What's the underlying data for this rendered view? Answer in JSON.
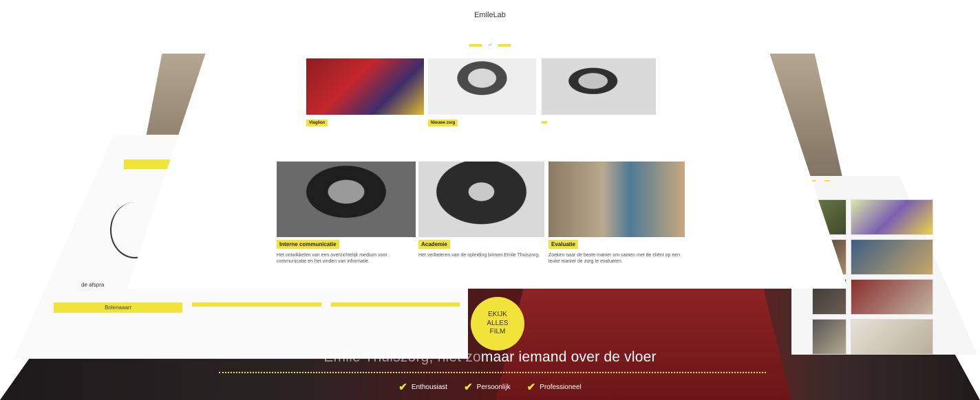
{
  "colors": {
    "accent": "#f2e33a",
    "hero_dark": "#1c1a1b",
    "hero_red": "#7b1d1d"
  },
  "front": {
    "title": "EmileLab",
    "subtitle": "",
    "intro": "",
    "buttons": [
      "",
      ""
    ],
    "separator": "of",
    "cards": [
      {
        "label": "Vlaglion",
        "text": ""
      },
      {
        "label": "Nieuwe zorg",
        "text": ""
      },
      {
        "label": "",
        "text": ""
      },
      {
        "label": "Interne communicatie",
        "text": "Het ontwikkelen van een overzichtelijk medium voor communicatie en het vinden van informatie."
      },
      {
        "label": "Academie",
        "text": "Het verbeteren van de opleiding binnen Emile Thuiszorg."
      },
      {
        "label": "Evaluatie",
        "text": "Zoeken naar de beste manier om samen met de cliënt op een leuke manier de zorg te evalueren."
      }
    ]
  },
  "left_panel": {
    "link_text": "de afspra",
    "columns": [
      {
        "head": "Bolenaaarr",
        "lines": [
          "",
          ""
        ]
      },
      {
        "head": "",
        "lines": [
          ""
        ]
      },
      {
        "head": "",
        "lines": [
          ""
        ]
      }
    ]
  },
  "right_panel": {
    "tabs": [
      "",
      ""
    ],
    "thumb_count": 8
  },
  "hero": {
    "tagline_dim": "Emile Thuiszorg, niet zo",
    "tagline_main": "maar iemand over de vloer",
    "badge_lines": [
      "EKIJK",
      "ALLES",
      "FILM"
    ],
    "points": [
      "Enthousiast",
      "Persoonlijk",
      "Professioneel"
    ]
  }
}
